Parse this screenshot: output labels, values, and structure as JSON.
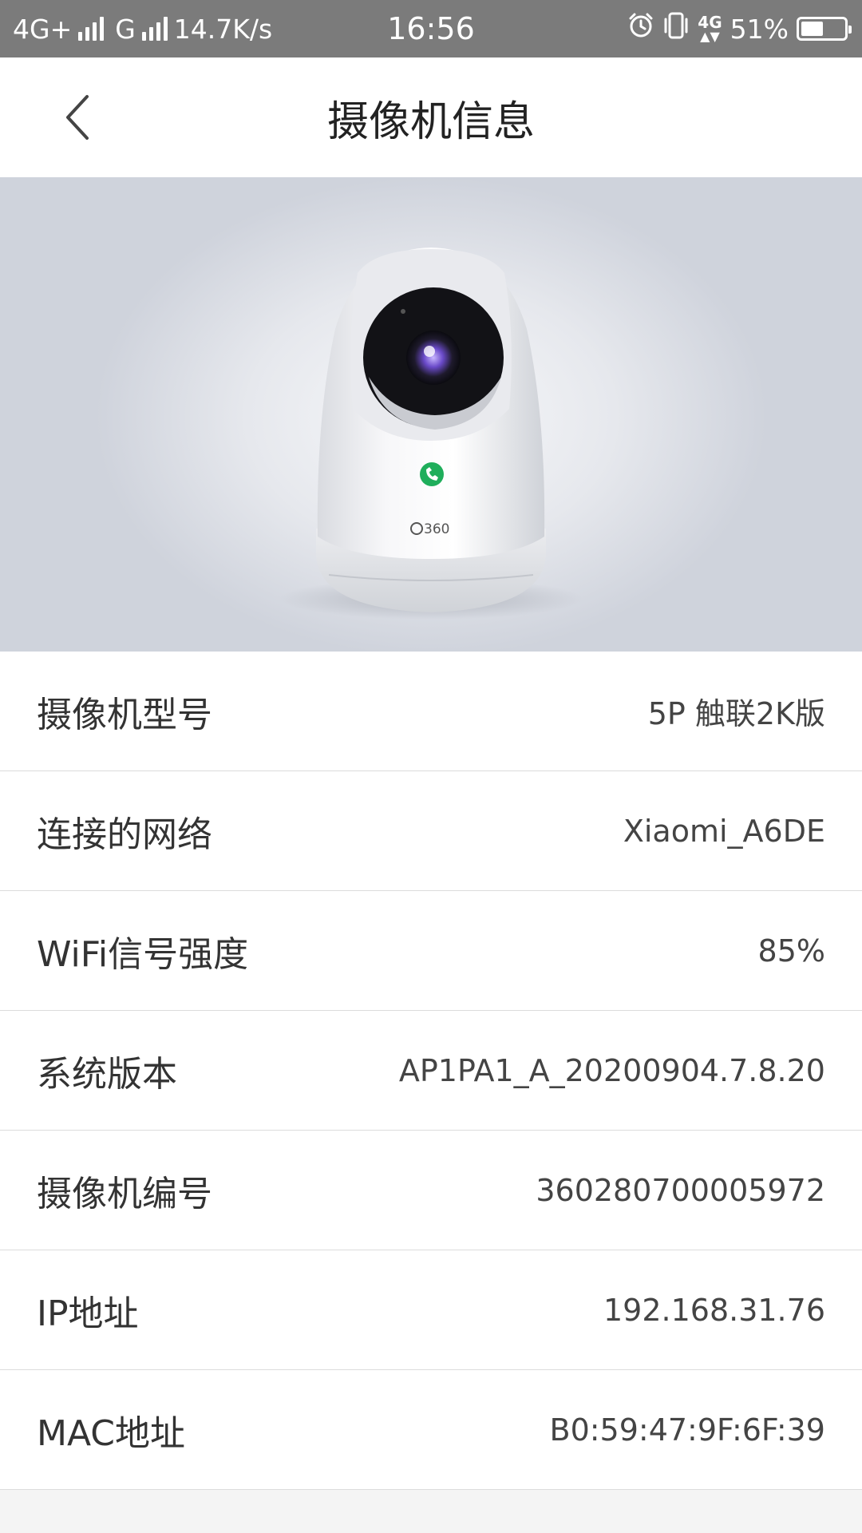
{
  "status_bar": {
    "network_left": "4G+",
    "network_mid": "G",
    "speed": "14.7K/s",
    "time": "16:56",
    "mini_network": "4G",
    "battery_percent": "51%",
    "battery_level": 0.51,
    "icons": [
      "signal-icon",
      "alarm-icon",
      "vibrate-icon",
      "battery-icon"
    ]
  },
  "header": {
    "title": "摄像机信息",
    "back_icon": "chevron-left-icon"
  },
  "hero": {
    "brand": "360"
  },
  "info": {
    "rows": [
      {
        "label": "摄像机型号",
        "value": "5P 触联2K版"
      },
      {
        "label": "连接的网络",
        "value": "Xiaomi_A6DE"
      },
      {
        "label": "WiFi信号强度",
        "value": "85%"
      },
      {
        "label": "系统版本",
        "value": "AP1PA1_A_20200904.7.8.20"
      },
      {
        "label": "摄像机编号",
        "value": "360280700005972"
      },
      {
        "label": "IP地址",
        "value": "192.168.31.76"
      },
      {
        "label": "MAC地址",
        "value": "B0:59:47:9F:6F:39"
      }
    ]
  }
}
